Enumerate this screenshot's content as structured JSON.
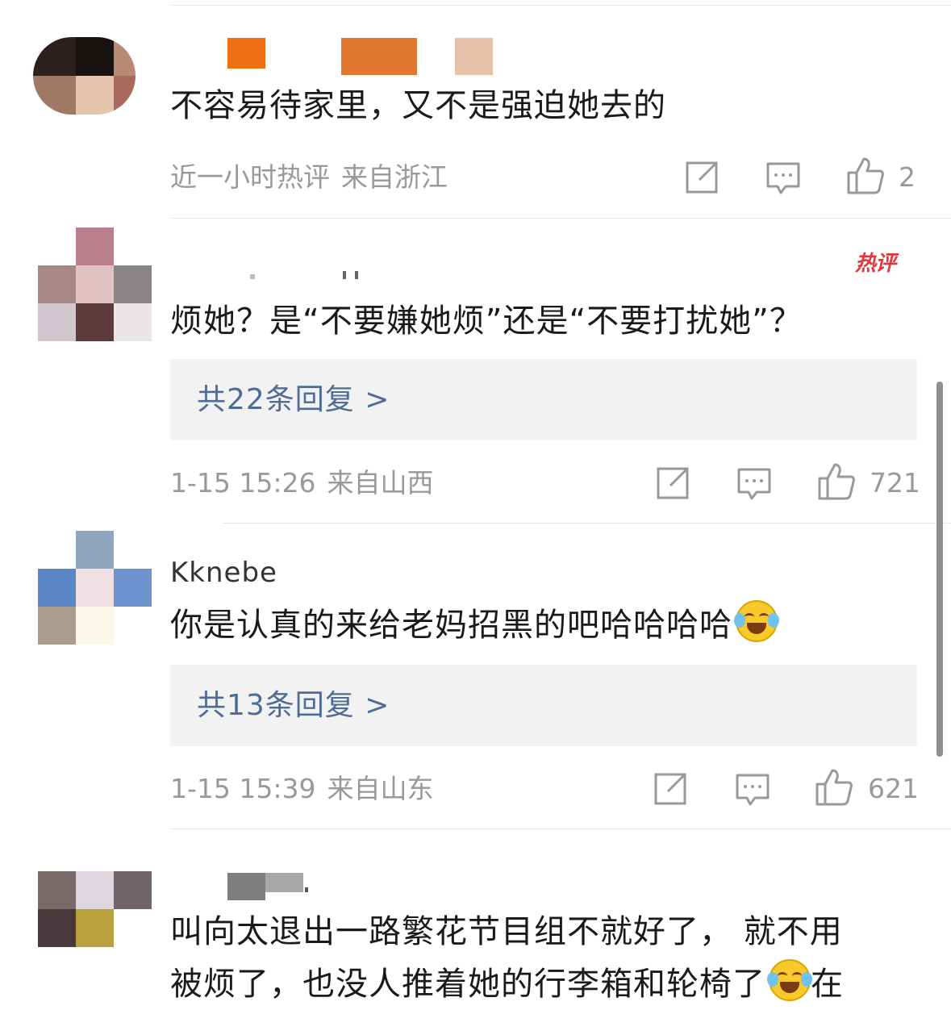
{
  "comments": [
    {
      "text": "不容易待家里，又不是强迫她去的",
      "time": "近一小时热评",
      "location": "来自浙江",
      "likes": "2"
    },
    {
      "badge": "热评",
      "text": "烦她？是“不要嫌她烦”还是“不要打扰她”？",
      "replies": "共22条回复 >",
      "time": "1-15 15:26",
      "location": "来自山西",
      "likes": "721"
    },
    {
      "username": "Kknebe",
      "text": "你是认真的来给老妈招黑的吧哈哈哈哈",
      "replies": "共13条回复 >",
      "time": "1-15 15:39",
      "location": "来自山东",
      "likes": "621"
    },
    {
      "text_line1": "叫向太退出一路繁花节目组不就好了， 就不用",
      "text_line2": "被烦了，也没人推着她的行李箱和轮椅了",
      "text_line2_tail": "在"
    }
  ],
  "icons": {
    "share": "share-icon",
    "comment": "comment-icon",
    "like": "thumbs-up-icon",
    "emoji": "laugh-cry-emoji-icon"
  },
  "colors": {
    "reply_link": "#4f6d94",
    "hot_badge": "#e0393b",
    "meta_text": "#999999"
  }
}
